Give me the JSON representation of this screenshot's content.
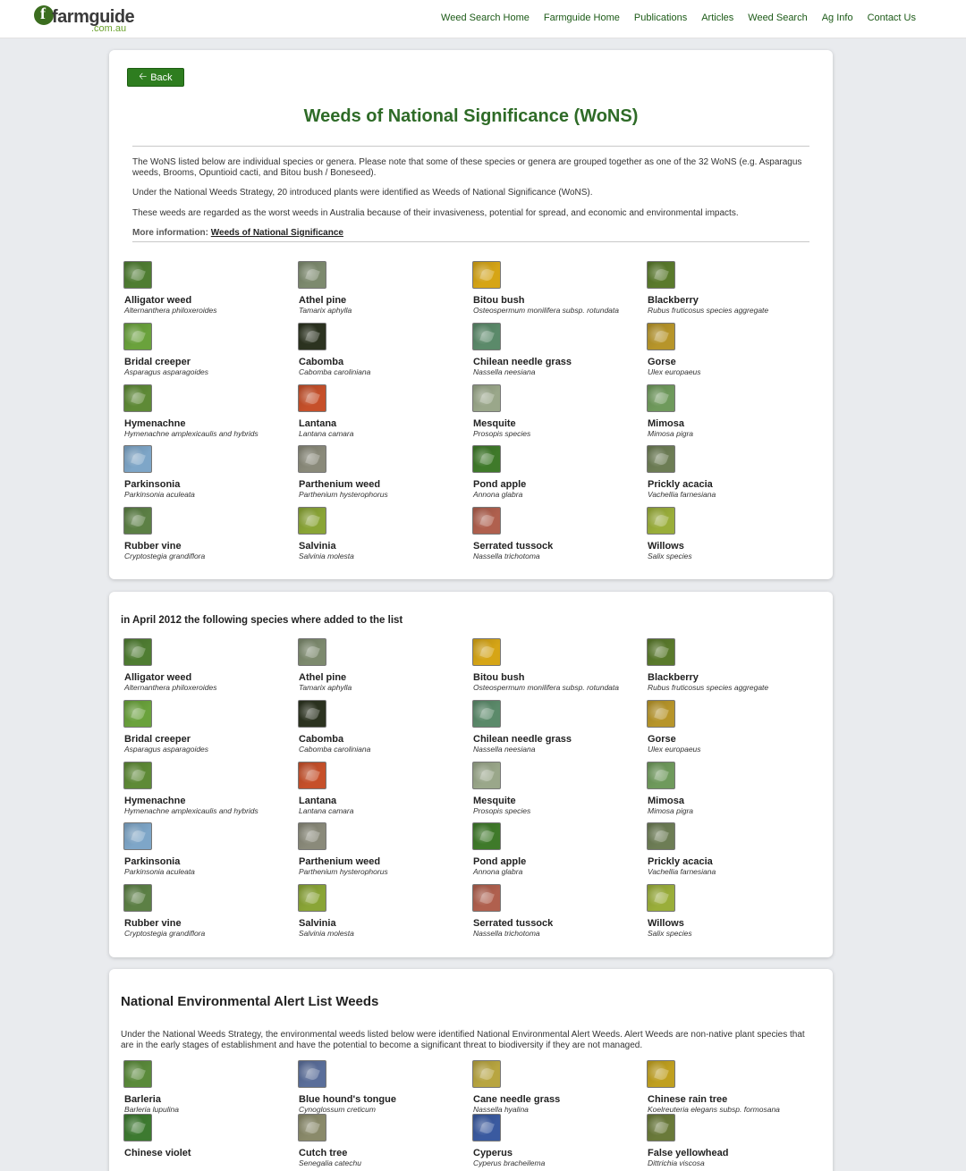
{
  "header": {
    "logo_text": "farmguide",
    "logo_sub": ".com.au",
    "nav": [
      "Weed Search Home",
      "Farmguide Home",
      "Publications",
      "Articles",
      "Weed Search",
      "Ag Info",
      "Contact Us"
    ]
  },
  "wons": {
    "back_label": "Back",
    "title": "Weeds of National Significance (WoNS)",
    "para1": "The WoNS listed below are individual species or genera. Please note that some of these species or genera are grouped together as one of the 32 WoNS (e.g. Asparagus weeds, Brooms, Opuntioid cacti, and Bitou bush / Boneseed).",
    "para2": "Under the National Weeds Strategy, 20 introduced plants were identified as Weeds of National Significance (WoNS).",
    "para3": "These weeds are regarded as the worst weeds in Australia because of their invasiveness, potential for spread, and economic and environmental impacts.",
    "more_label": "More information:",
    "more_link": "Weeds of National Significance",
    "items": [
      {
        "name": "Alligator weed",
        "sci": "Alternanthera philoxeroides",
        "color": "#4f7d32"
      },
      {
        "name": "Athel pine",
        "sci": "Tamarix aphylla",
        "color": "#7d8a6e"
      },
      {
        "name": "Bitou bush",
        "sci": "Osteospermum monilifera subsp. rotundata",
        "color": "#d6a516"
      },
      {
        "name": "Blackberry",
        "sci": "Rubus fruticosus species aggregate",
        "color": "#5a7a2c"
      },
      {
        "name": "Bridal creeper",
        "sci": "Asparagus asparagoides",
        "color": "#6aa23c"
      },
      {
        "name": "Cabomba",
        "sci": "Cabomba caroliniana",
        "color": "#2c3320"
      },
      {
        "name": "Chilean needle grass",
        "sci": "Nassella neesiana",
        "color": "#5b8a6a"
      },
      {
        "name": "Gorse",
        "sci": "Ulex europaeus",
        "color": "#b7952a"
      },
      {
        "name": "Hymenachne",
        "sci": "Hymenachne amplexicaulis and hybrids",
        "color": "#5e8a36"
      },
      {
        "name": "Lantana",
        "sci": "Lantana camara",
        "color": "#c6502a"
      },
      {
        "name": "Mesquite",
        "sci": "Prosopis species",
        "color": "#9aa78a"
      },
      {
        "name": "Mimosa",
        "sci": "Mimosa pigra",
        "color": "#6f9a5c"
      },
      {
        "name": "Parkinsonia",
        "sci": "Parkinsonia aculeata",
        "color": "#7ea6c8"
      },
      {
        "name": "Parthenium weed",
        "sci": "Parthenium hysterophorus",
        "color": "#8a8a7a"
      },
      {
        "name": "Pond apple",
        "sci": "Annona glabra",
        "color": "#3f7a2a"
      },
      {
        "name": "Prickly acacia",
        "sci": "Vachellia farnesiana",
        "color": "#6d7d55"
      },
      {
        "name": "Rubber vine",
        "sci": "Cryptostegia grandiflora",
        "color": "#5c8045"
      },
      {
        "name": "Salvinia",
        "sci": "Salvinia molesta",
        "color": "#8aa536"
      },
      {
        "name": "Serrated tussock",
        "sci": "Nassella trichotoma",
        "color": "#b0604e"
      },
      {
        "name": "Willows",
        "sci": "Salix species",
        "color": "#9aae3a"
      }
    ]
  },
  "april": {
    "heading": "in April 2012 the following species where added to the list",
    "items": [
      {
        "name": "Alligator weed",
        "sci": "Alternanthera philoxeroides",
        "color": "#4f7d32"
      },
      {
        "name": "Athel pine",
        "sci": "Tamarix aphylla",
        "color": "#7d8a6e"
      },
      {
        "name": "Bitou bush",
        "sci": "Osteospermum monilifera subsp. rotundata",
        "color": "#d6a516"
      },
      {
        "name": "Blackberry",
        "sci": "Rubus fruticosus species aggregate",
        "color": "#5a7a2c"
      },
      {
        "name": "Bridal creeper",
        "sci": "Asparagus asparagoides",
        "color": "#6aa23c"
      },
      {
        "name": "Cabomba",
        "sci": "Cabomba caroliniana",
        "color": "#2c3320"
      },
      {
        "name": "Chilean needle grass",
        "sci": "Nassella neesiana",
        "color": "#5b8a6a"
      },
      {
        "name": "Gorse",
        "sci": "Ulex europaeus",
        "color": "#b7952a"
      },
      {
        "name": "Hymenachne",
        "sci": "Hymenachne amplexicaulis and hybrids",
        "color": "#5e8a36"
      },
      {
        "name": "Lantana",
        "sci": "Lantana camara",
        "color": "#c6502a"
      },
      {
        "name": "Mesquite",
        "sci": "Prosopis species",
        "color": "#9aa78a"
      },
      {
        "name": "Mimosa",
        "sci": "Mimosa pigra",
        "color": "#6f9a5c"
      },
      {
        "name": "Parkinsonia",
        "sci": "Parkinsonia aculeata",
        "color": "#7ea6c8"
      },
      {
        "name": "Parthenium weed",
        "sci": "Parthenium hysterophorus",
        "color": "#8a8a7a"
      },
      {
        "name": "Pond apple",
        "sci": "Annona glabra",
        "color": "#3f7a2a"
      },
      {
        "name": "Prickly acacia",
        "sci": "Vachellia farnesiana",
        "color": "#6d7d55"
      },
      {
        "name": "Rubber vine",
        "sci": "Cryptostegia grandiflora",
        "color": "#5c8045"
      },
      {
        "name": "Salvinia",
        "sci": "Salvinia molesta",
        "color": "#8aa536"
      },
      {
        "name": "Serrated tussock",
        "sci": "Nassella trichotoma",
        "color": "#b0604e"
      },
      {
        "name": "Willows",
        "sci": "Salix species",
        "color": "#9aae3a"
      }
    ]
  },
  "alert": {
    "heading": "National Environmental Alert List Weeds",
    "description": "Under the National Weeds Strategy, the environmental weeds listed below were identified National Environmental Alert Weeds. Alert Weeds are non-native plant species that are in the early stages of establishment and have the potential to become a significant threat to biodiversity if they are not managed.",
    "items": [
      {
        "name": "Barleria",
        "sci": "Barleria lupulina",
        "color": "#5a8a3a"
      },
      {
        "name": "Blue hound's tongue",
        "sci": "Cynoglossum creticum",
        "color": "#5a6e9a"
      },
      {
        "name": "Cane needle grass",
        "sci": "Nassella hyalina",
        "color": "#b8a540"
      },
      {
        "name": "Chinese rain tree",
        "sci": "Koelreuteria elegans subsp. formosana",
        "color": "#c0a020"
      },
      {
        "name": "Chinese violet",
        "sci": "",
        "color": "#3d7a30"
      },
      {
        "name": "Cutch tree",
        "sci": "Senegalia catechu",
        "color": "#8a8a6a"
      },
      {
        "name": "Cyperus",
        "sci": "Cyperus bracheilema",
        "color": "#3a5aa0"
      },
      {
        "name": "False yellowhead",
        "sci": "Dittrichia viscosa",
        "color": "#6a7a3a"
      }
    ]
  }
}
